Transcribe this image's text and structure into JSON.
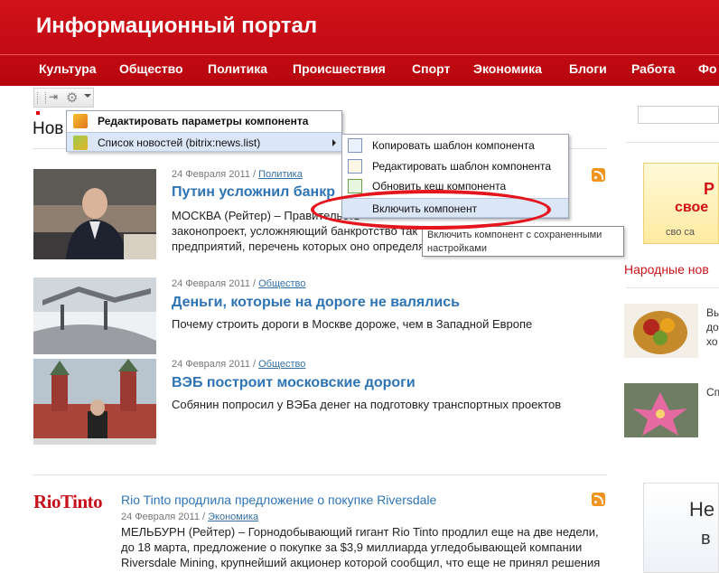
{
  "header": {
    "site_title": "Информационный портал",
    "nav": [
      "Культура",
      "Общество",
      "Политика",
      "Происшествия",
      "Спорт",
      "Экономика",
      "Блоги",
      "Работа",
      "Фо"
    ]
  },
  "main": {
    "section_heading": "Нов",
    "news": [
      {
        "date": "24 Февраля 2011",
        "category": "Политика",
        "title": "Путин усложнил банкр",
        "text_line1": "МОСКВА (Рейтер) – Правительств",
        "text_line2": "законопроект, усложняющий банкротство так",
        "text_line3": "предприятий, перечень которых оно определя"
      },
      {
        "date": "24 Февраля 2011",
        "category": "Общество",
        "title": "Деньги, которые на дороге не валялись",
        "text": "Почему строить дороги в Москве дороже, чем в Западной Европе"
      },
      {
        "date": "24 Февраля 2011",
        "category": "Общество",
        "title": "ВЭБ построит московские дороги",
        "text": "Собянин попросил у ВЭБа денег на подготовку транспортных проектов"
      },
      {
        "logo": "RioTinto",
        "title": "Rio Tinto продлила предложение о покупке Riversdale",
        "date": "24 Февраля 2011",
        "category": "Экономика",
        "text_line1": "МЕЛЬБУРН (Рейтер) – Горнодобывающий гигант Rio Tinto продлил еще на две недели,",
        "text_line2": "до 18 марта, предложение о покупке за $3,9 миллиарда угледобывающей компании",
        "text_line3": "Riversdale Mining, крупнейший акционер которой сообщил, что еще не принял решения"
      }
    ]
  },
  "context_menu": {
    "items": [
      {
        "label": "Редактировать параметры компонента",
        "icon": "settings-icon"
      },
      {
        "label": "Список новостей (bitrix:news.list)",
        "icon": "component-icon"
      }
    ],
    "submenu": [
      {
        "label": "Копировать шаблон компонента",
        "icon": "copy-template-icon"
      },
      {
        "label": "Редактировать шаблон компонента",
        "icon": "edit-template-icon"
      },
      {
        "label": "Обновить кеш компонента",
        "icon": "refresh-cache-icon"
      },
      {
        "label": "Включить компонент",
        "icon": ""
      }
    ],
    "tooltip": "Включить компонент с сохраненными настройками"
  },
  "right": {
    "ad_top_line1": "Р",
    "ad_top_line2": "свое",
    "ad_top_line3": "сво са",
    "heading": "Народные нов",
    "item1_line1": "Вы",
    "item1_line2": "до",
    "item1_line3": "хо",
    "item2_line1": "Сп",
    "item2_line2": "",
    "ad_bottom_line1": "Не",
    "ad_bottom_line2": "в"
  },
  "colors": {
    "header_red": "#c80a12",
    "link_blue": "#2e74b5",
    "highlight_ellipse": "#e4151c",
    "rss_orange": "#f29420"
  }
}
